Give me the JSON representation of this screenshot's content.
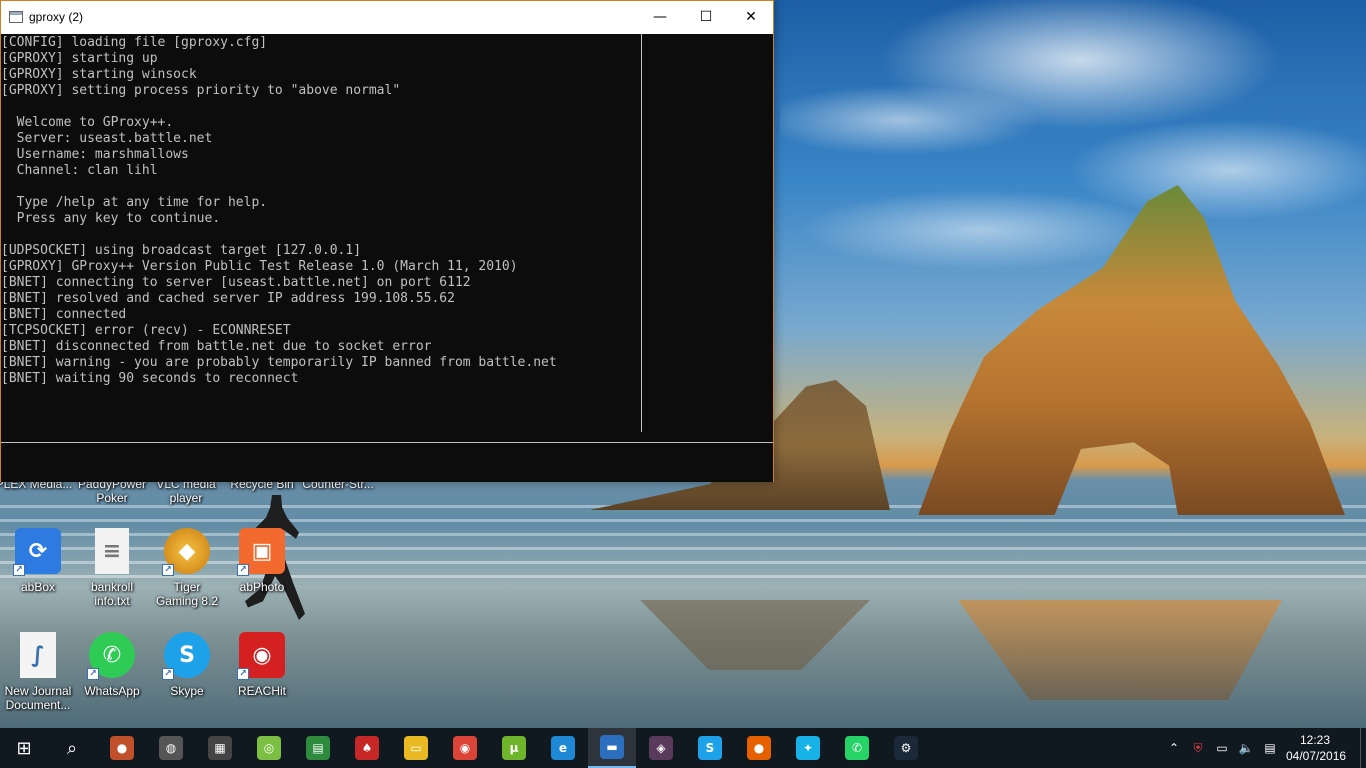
{
  "window": {
    "title": "gproxy (2)",
    "minimize_glyph": "—",
    "maximize_glyph": "☐",
    "close_glyph": "✕"
  },
  "console": {
    "lines": [
      "[CONFIG] loading file [gproxy.cfg]",
      "[GPROXY] starting up",
      "[GPROXY] starting winsock",
      "[GPROXY] setting process priority to \"above normal\"",
      "",
      "  Welcome to GProxy++.",
      "  Server: useast.battle.net",
      "  Username: marshmallows",
      "  Channel: clan lihl",
      "",
      "  Type /help at any time for help.",
      "  Press any key to continue.",
      "",
      "[UDPSOCKET] using broadcast target [127.0.0.1]",
      "[GPROXY] GProxy++ Version Public Test Release 1.0 (March 11, 2010)",
      "[BNET] connecting to server [useast.battle.net] on port 6112",
      "[BNET] resolved and cached server IP address 199.108.55.62",
      "[BNET] connected",
      "[TCPSOCKET] error (recv) - ECONNRESET",
      "[BNET] disconnected from battle.net due to socket error",
      "[BNET] warning - you are probably temporarily IP banned from battle.net",
      "[BNET] waiting 90 seconds to reconnect"
    ]
  },
  "desktop": {
    "partial_row": [
      "PLEX Media...",
      "PaddyPower\nPoker",
      "VLC media\nplayer",
      "Recycle Bin",
      "Counter-Str..."
    ],
    "icons": [
      {
        "label": "abBox",
        "glyph": "⟳",
        "color": "#2d7be0"
      },
      {
        "label": "bankroll\ninfo.txt",
        "glyph": "≡",
        "color": "#f2f2f2"
      },
      {
        "label": "Tiger\nGaming 8.2",
        "glyph": "◆",
        "color": "#e0a020"
      },
      {
        "label": "abPhoto",
        "glyph": "▣",
        "color": "#f26a2e"
      },
      {
        "label": "New Journal\nDocument...",
        "glyph": "∫",
        "color": "#f4f4f4"
      },
      {
        "label": "WhatsApp",
        "glyph": "✆",
        "color": "#2ecc55"
      },
      {
        "label": "Skype",
        "glyph": "S",
        "color": "#1da1e8"
      },
      {
        "label": "REACHit",
        "glyph": "◉",
        "color": "#d42020"
      }
    ]
  },
  "taskbar": {
    "start_glyph": "⊞",
    "search_glyph": "⌕",
    "apps": [
      {
        "name": "firefox-alt",
        "glyph": "●",
        "color": "#c0502a"
      },
      {
        "name": "unknown-app",
        "glyph": "◍",
        "color": "#555555"
      },
      {
        "name": "store",
        "glyph": "▦",
        "color": "#444444"
      },
      {
        "name": "cash-app",
        "glyph": "◎",
        "color": "#7bc043"
      },
      {
        "name": "notes",
        "glyph": "▤",
        "color": "#2e8b3e"
      },
      {
        "name": "pokerstars",
        "glyph": "♠",
        "color": "#c62828"
      },
      {
        "name": "file-explorer",
        "glyph": "▭",
        "color": "#e8b923"
      },
      {
        "name": "chrome",
        "glyph": "◉",
        "color": "#db4437"
      },
      {
        "name": "utorrent",
        "glyph": "µ",
        "color": "#6fb52c"
      },
      {
        "name": "internet-explorer",
        "glyph": "e",
        "color": "#1e88d4"
      },
      {
        "name": "console",
        "glyph": "▬",
        "color": "#2c6fbf"
      },
      {
        "name": "game",
        "glyph": "◈",
        "color": "#5a3a5a"
      },
      {
        "name": "skype",
        "glyph": "S",
        "color": "#1da1e8"
      },
      {
        "name": "firefox",
        "glyph": "●",
        "color": "#e66000"
      },
      {
        "name": "kodi",
        "glyph": "✦",
        "color": "#17b2e7"
      },
      {
        "name": "whatsapp",
        "glyph": "✆",
        "color": "#25d366"
      },
      {
        "name": "steam",
        "glyph": "⚙",
        "color": "#1b2838"
      }
    ],
    "tray": {
      "chevron": "⌃",
      "shield": "⛨",
      "network": "▭",
      "volume": "🔈",
      "notifications": "▤"
    },
    "time": "12:23",
    "date": "04/07/2016"
  }
}
